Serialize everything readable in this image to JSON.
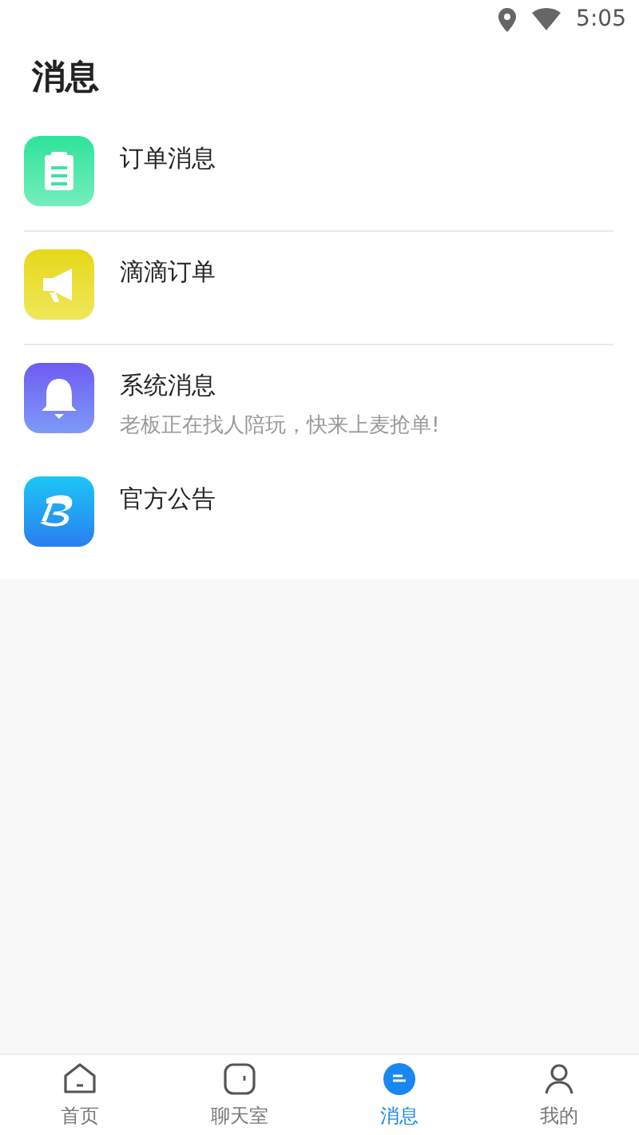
{
  "status_bar": {
    "time": "5:05"
  },
  "title": "消息",
  "messages": [
    {
      "kind": "order",
      "title": "订单消息",
      "divider": true
    },
    {
      "kind": "horn",
      "title": "滴滴订单",
      "divider": true
    },
    {
      "kind": "bell",
      "title": "系统消息",
      "preview": "老板正在找人陪玩，快来上麦抢单!",
      "divider": false
    },
    {
      "kind": "brand",
      "title": "官方公告",
      "divider": false
    }
  ],
  "tabs": [
    {
      "kind": "home",
      "label": "首页",
      "selected": false
    },
    {
      "kind": "chat",
      "label": "聊天室",
      "selected": false
    },
    {
      "kind": "message",
      "label": "消息",
      "selected": true
    },
    {
      "kind": "me",
      "label": "我的",
      "selected": false
    }
  ]
}
